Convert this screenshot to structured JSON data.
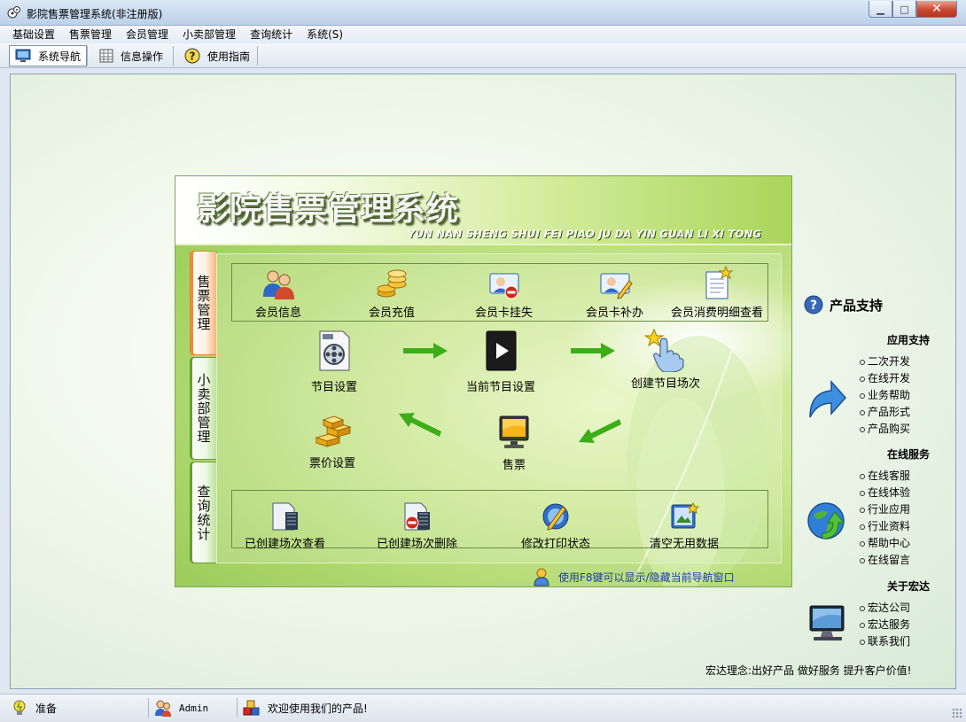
{
  "window": {
    "title": "影院售票管理系统(非注册版)",
    "app_icon": "app-logo-icon",
    "controls": {
      "minimize": "▁",
      "maximize": "□",
      "close": "✕"
    }
  },
  "menubar": {
    "items": [
      "基础设置",
      "售票管理",
      "会员管理",
      "小卖部管理",
      "查询统计",
      "系统(S)"
    ]
  },
  "toolbar": {
    "items": [
      {
        "label": "系统导航",
        "icon": "monitor-icon"
      },
      {
        "label": "信息操作",
        "icon": "grid-table-icon"
      },
      {
        "label": "使用指南",
        "icon": "help-icon"
      }
    ]
  },
  "nav": {
    "title": "影院售票管理系统",
    "subtitle": "YUN NAN SHENG SHUI FEI PIAO JU DA YIN GUAN LI XI TONG",
    "tabs": [
      "售票管理",
      "小卖部管理",
      "查询统计"
    ],
    "top_items": [
      "会员信息",
      "会员充值",
      "会员卡挂失",
      "会员卡补办",
      "会员消费明细查看"
    ],
    "flow_items": [
      "节目设置",
      "当前节目设置",
      "创建节目场次",
      "票价设置",
      "售票"
    ],
    "bottom_items": [
      "已创建场次查看",
      "已创建场次删除",
      "修改打印状态",
      "清空无用数据"
    ],
    "hint": "使用F8键可以显示/隐藏当前导航窗口"
  },
  "sidebar": {
    "support_title": "产品支持",
    "sections": [
      {
        "title": "应用支持",
        "links": [
          "二次开发",
          "在线开发",
          "业务帮助",
          "产品形式",
          "产品购买"
        ]
      },
      {
        "title": "在线服务",
        "links": [
          "在线客服",
          "在线体验",
          "行业应用",
          "行业资料",
          "帮助中心",
          "在线留言"
        ]
      },
      {
        "title": "关于宏达",
        "links": [
          "宏达公司",
          "宏达服务",
          "联系我们"
        ]
      }
    ],
    "slogan": "宏达理念:出好产品 做好服务 提升客户价值!"
  },
  "statusbar": {
    "status": "准备",
    "user": "Admin",
    "welcome": "欢迎使用我们的产品!"
  },
  "colors": {
    "accent_green": "#3cae1a",
    "active_tab": "#f38c2e",
    "link_blue": "#1d3ea8"
  }
}
